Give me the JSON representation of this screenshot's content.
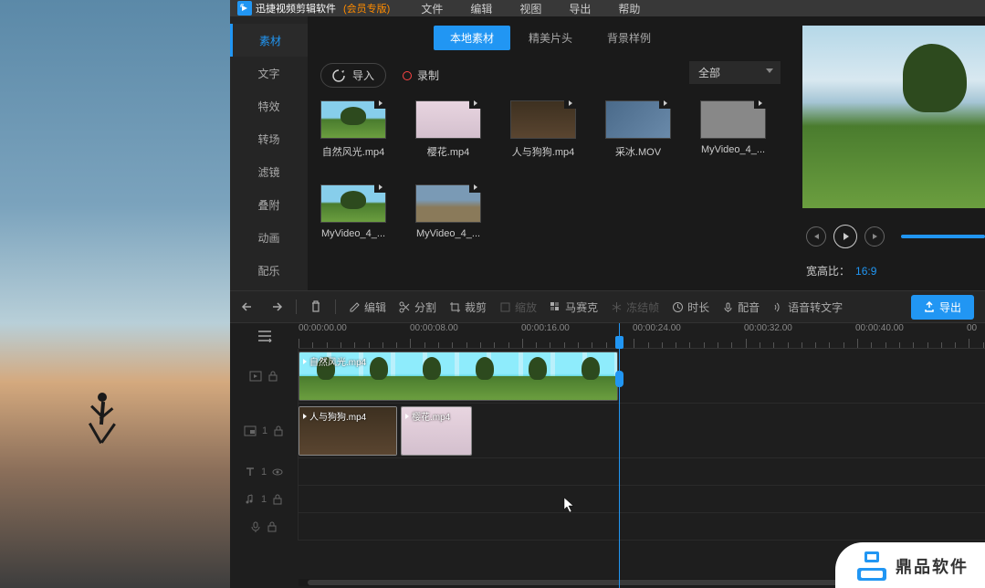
{
  "app": {
    "title": "迅捷视频剪辑软件",
    "version": "(会员专版)"
  },
  "menu": {
    "file": "文件",
    "edit": "编辑",
    "view": "视图",
    "export": "导出",
    "help": "帮助"
  },
  "sidebar": {
    "material": "素材",
    "text": "文字",
    "effect": "特效",
    "transition": "转场",
    "filter": "滤镜",
    "overlay": "叠附",
    "animation": "动画",
    "music": "配乐"
  },
  "subtabs": {
    "local": "本地素材",
    "intro": "精美片头",
    "bg": "背景样例"
  },
  "mediabar": {
    "import": "导入",
    "record": "录制",
    "filter": "全部"
  },
  "media": {
    "items": [
      {
        "name": "自然风光.mp4"
      },
      {
        "name": "樱花.mp4"
      },
      {
        "name": "人与狗狗.mp4"
      },
      {
        "name": "采冰.MOV"
      },
      {
        "name": "MyVideo_4_..."
      },
      {
        "name": "MyVideo_4_..."
      },
      {
        "name": "MyVideo_4_..."
      }
    ]
  },
  "preview": {
    "aspect_label": "宽高比：",
    "aspect_value": "16:9"
  },
  "toolbar": {
    "edit": "编辑",
    "split": "分割",
    "crop": "裁剪",
    "zoom": "缩放",
    "mosaic": "马赛克",
    "freeze": "冻结帧",
    "duration": "时长",
    "dub": "配音",
    "speech": "语音转文字",
    "export": "导出"
  },
  "ruler": {
    "t0": "00:00:00.00",
    "t1": "00:00:08.00",
    "t2": "00:00:16.00",
    "t3": "00:00:24.00",
    "t4": "00:00:32.00",
    "t5": "00:00:40.00",
    "t6": "00"
  },
  "clips": {
    "c1": "自然风光.mp4",
    "c2": "人与狗狗.mp4",
    "c3": "樱花.mp4"
  },
  "tracks": {
    "pip": "1",
    "text": "1",
    "audio": "1"
  },
  "watermark": {
    "text": "鼎品软件"
  }
}
